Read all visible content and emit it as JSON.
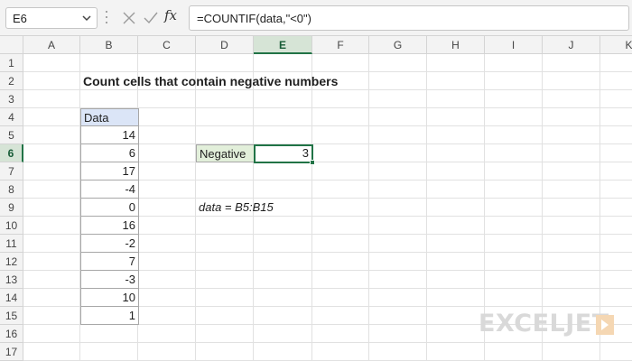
{
  "formula_bar": {
    "name_box": "E6",
    "formula": "=COUNTIF(data,\"<0\")",
    "fx_label": "fx"
  },
  "columns": [
    "A",
    "B",
    "C",
    "D",
    "E",
    "F",
    "G",
    "H",
    "I",
    "J",
    "K"
  ],
  "rows": [
    "1",
    "2",
    "3",
    "4",
    "5",
    "6",
    "7",
    "8",
    "9",
    "10",
    "11",
    "12",
    "13",
    "14",
    "15",
    "16",
    "17"
  ],
  "selected_cell": {
    "column": "E",
    "row": "6"
  },
  "sheet": {
    "title": "Count cells that contain negative numbers",
    "data_header": "Data",
    "data_values": [
      "14",
      "6",
      "17",
      "-4",
      "0",
      "16",
      "-2",
      "7",
      "-3",
      "10",
      "1"
    ],
    "negative_label": "Negative",
    "negative_result": "3",
    "named_range_note": "data = B5:B15"
  },
  "branding": {
    "logo_text": "EXCELJET"
  },
  "colors": {
    "accent_green": "#217346",
    "data_header_fill": "#dbe5f7",
    "label_fill": "#e2efda"
  }
}
